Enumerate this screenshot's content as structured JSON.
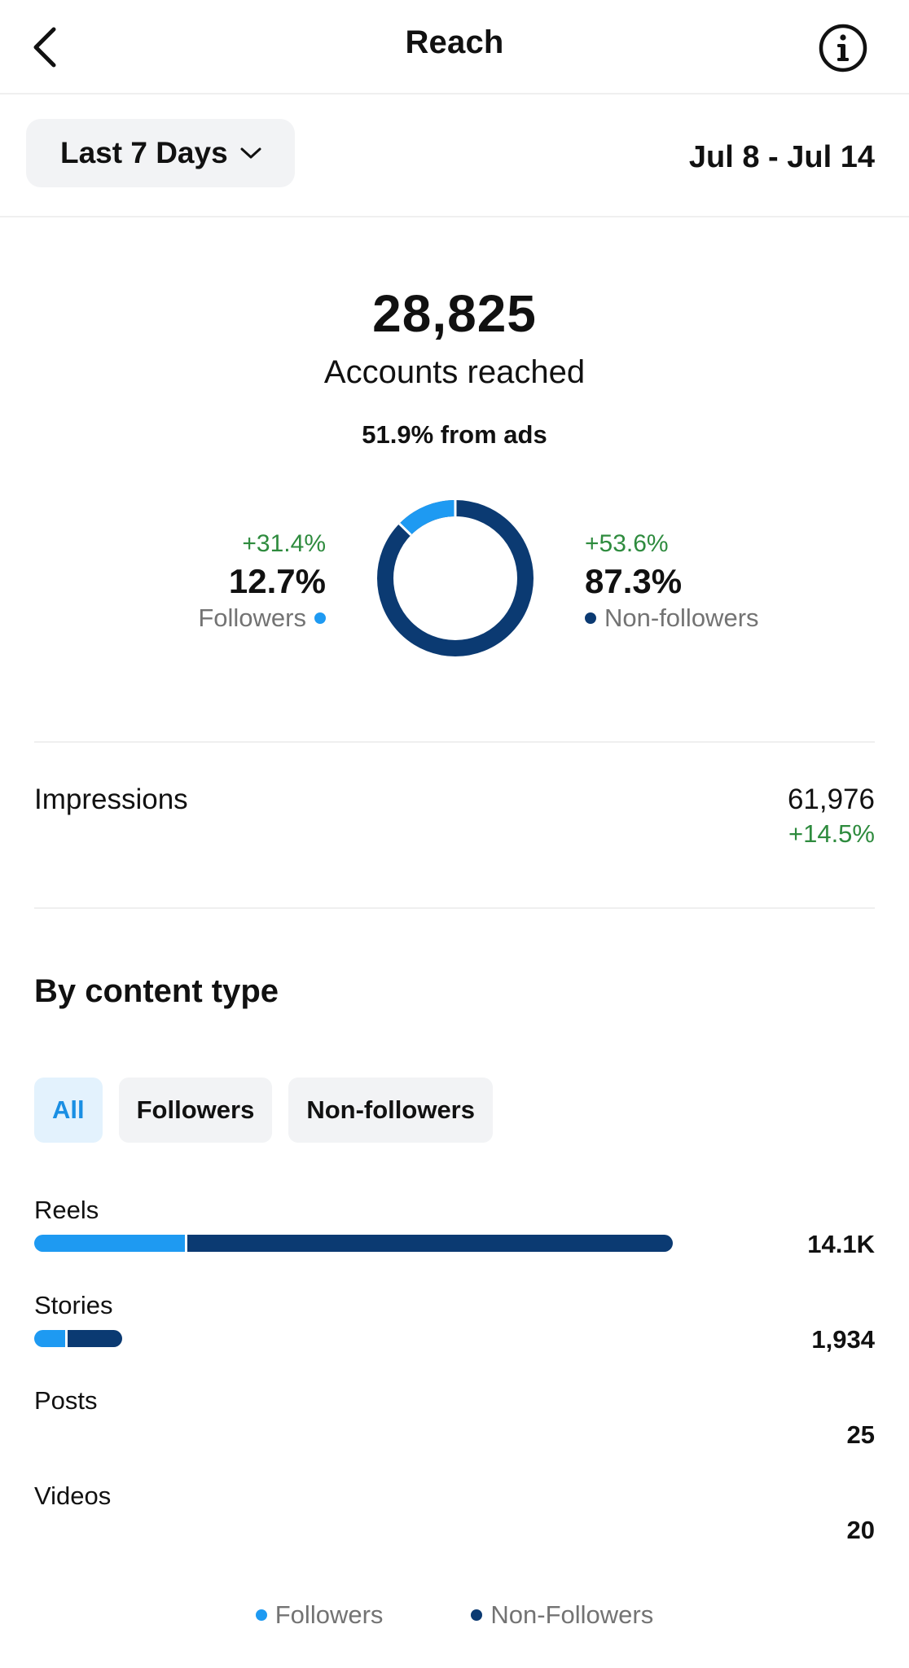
{
  "header": {
    "title": "Reach",
    "back_icon": "chevron-left-icon",
    "info_icon": "info-icon"
  },
  "filter": {
    "period_label": "Last 7 Days",
    "date_range": "Jul 8 - Jul 14"
  },
  "summary": {
    "accounts_value": "28,825",
    "accounts_label": "Accounts reached",
    "ads_label": "51.9% from ads"
  },
  "split": {
    "followers": {
      "delta": "+31.4%",
      "percent": "12.7%",
      "label": "Followers",
      "fraction": 0.127,
      "color": "#1e9af2"
    },
    "non_followers": {
      "delta": "+53.6%",
      "percent": "87.3%",
      "label": "Non-followers",
      "fraction": 0.873,
      "color": "#0b3a72"
    }
  },
  "impressions": {
    "label": "Impressions",
    "value": "61,976",
    "delta": "+14.5%"
  },
  "content_type": {
    "title": "By content type",
    "tabs": [
      "All",
      "Followers",
      "Non-followers"
    ],
    "active_tab": "All",
    "rows": [
      {
        "label": "Reels",
        "value": "14.1K",
        "bar_fraction": 0.76,
        "followers_fraction": 0.24
      },
      {
        "label": "Stories",
        "value": "1,934",
        "bar_fraction": 0.105,
        "followers_fraction": 0.38
      },
      {
        "label": "Posts",
        "value": "25",
        "bar_fraction": 0,
        "followers_fraction": 0
      },
      {
        "label": "Videos",
        "value": "20",
        "bar_fraction": 0,
        "followers_fraction": 0
      }
    ]
  },
  "legend": {
    "followers": "Followers",
    "non_followers": "Non-Followers"
  }
}
